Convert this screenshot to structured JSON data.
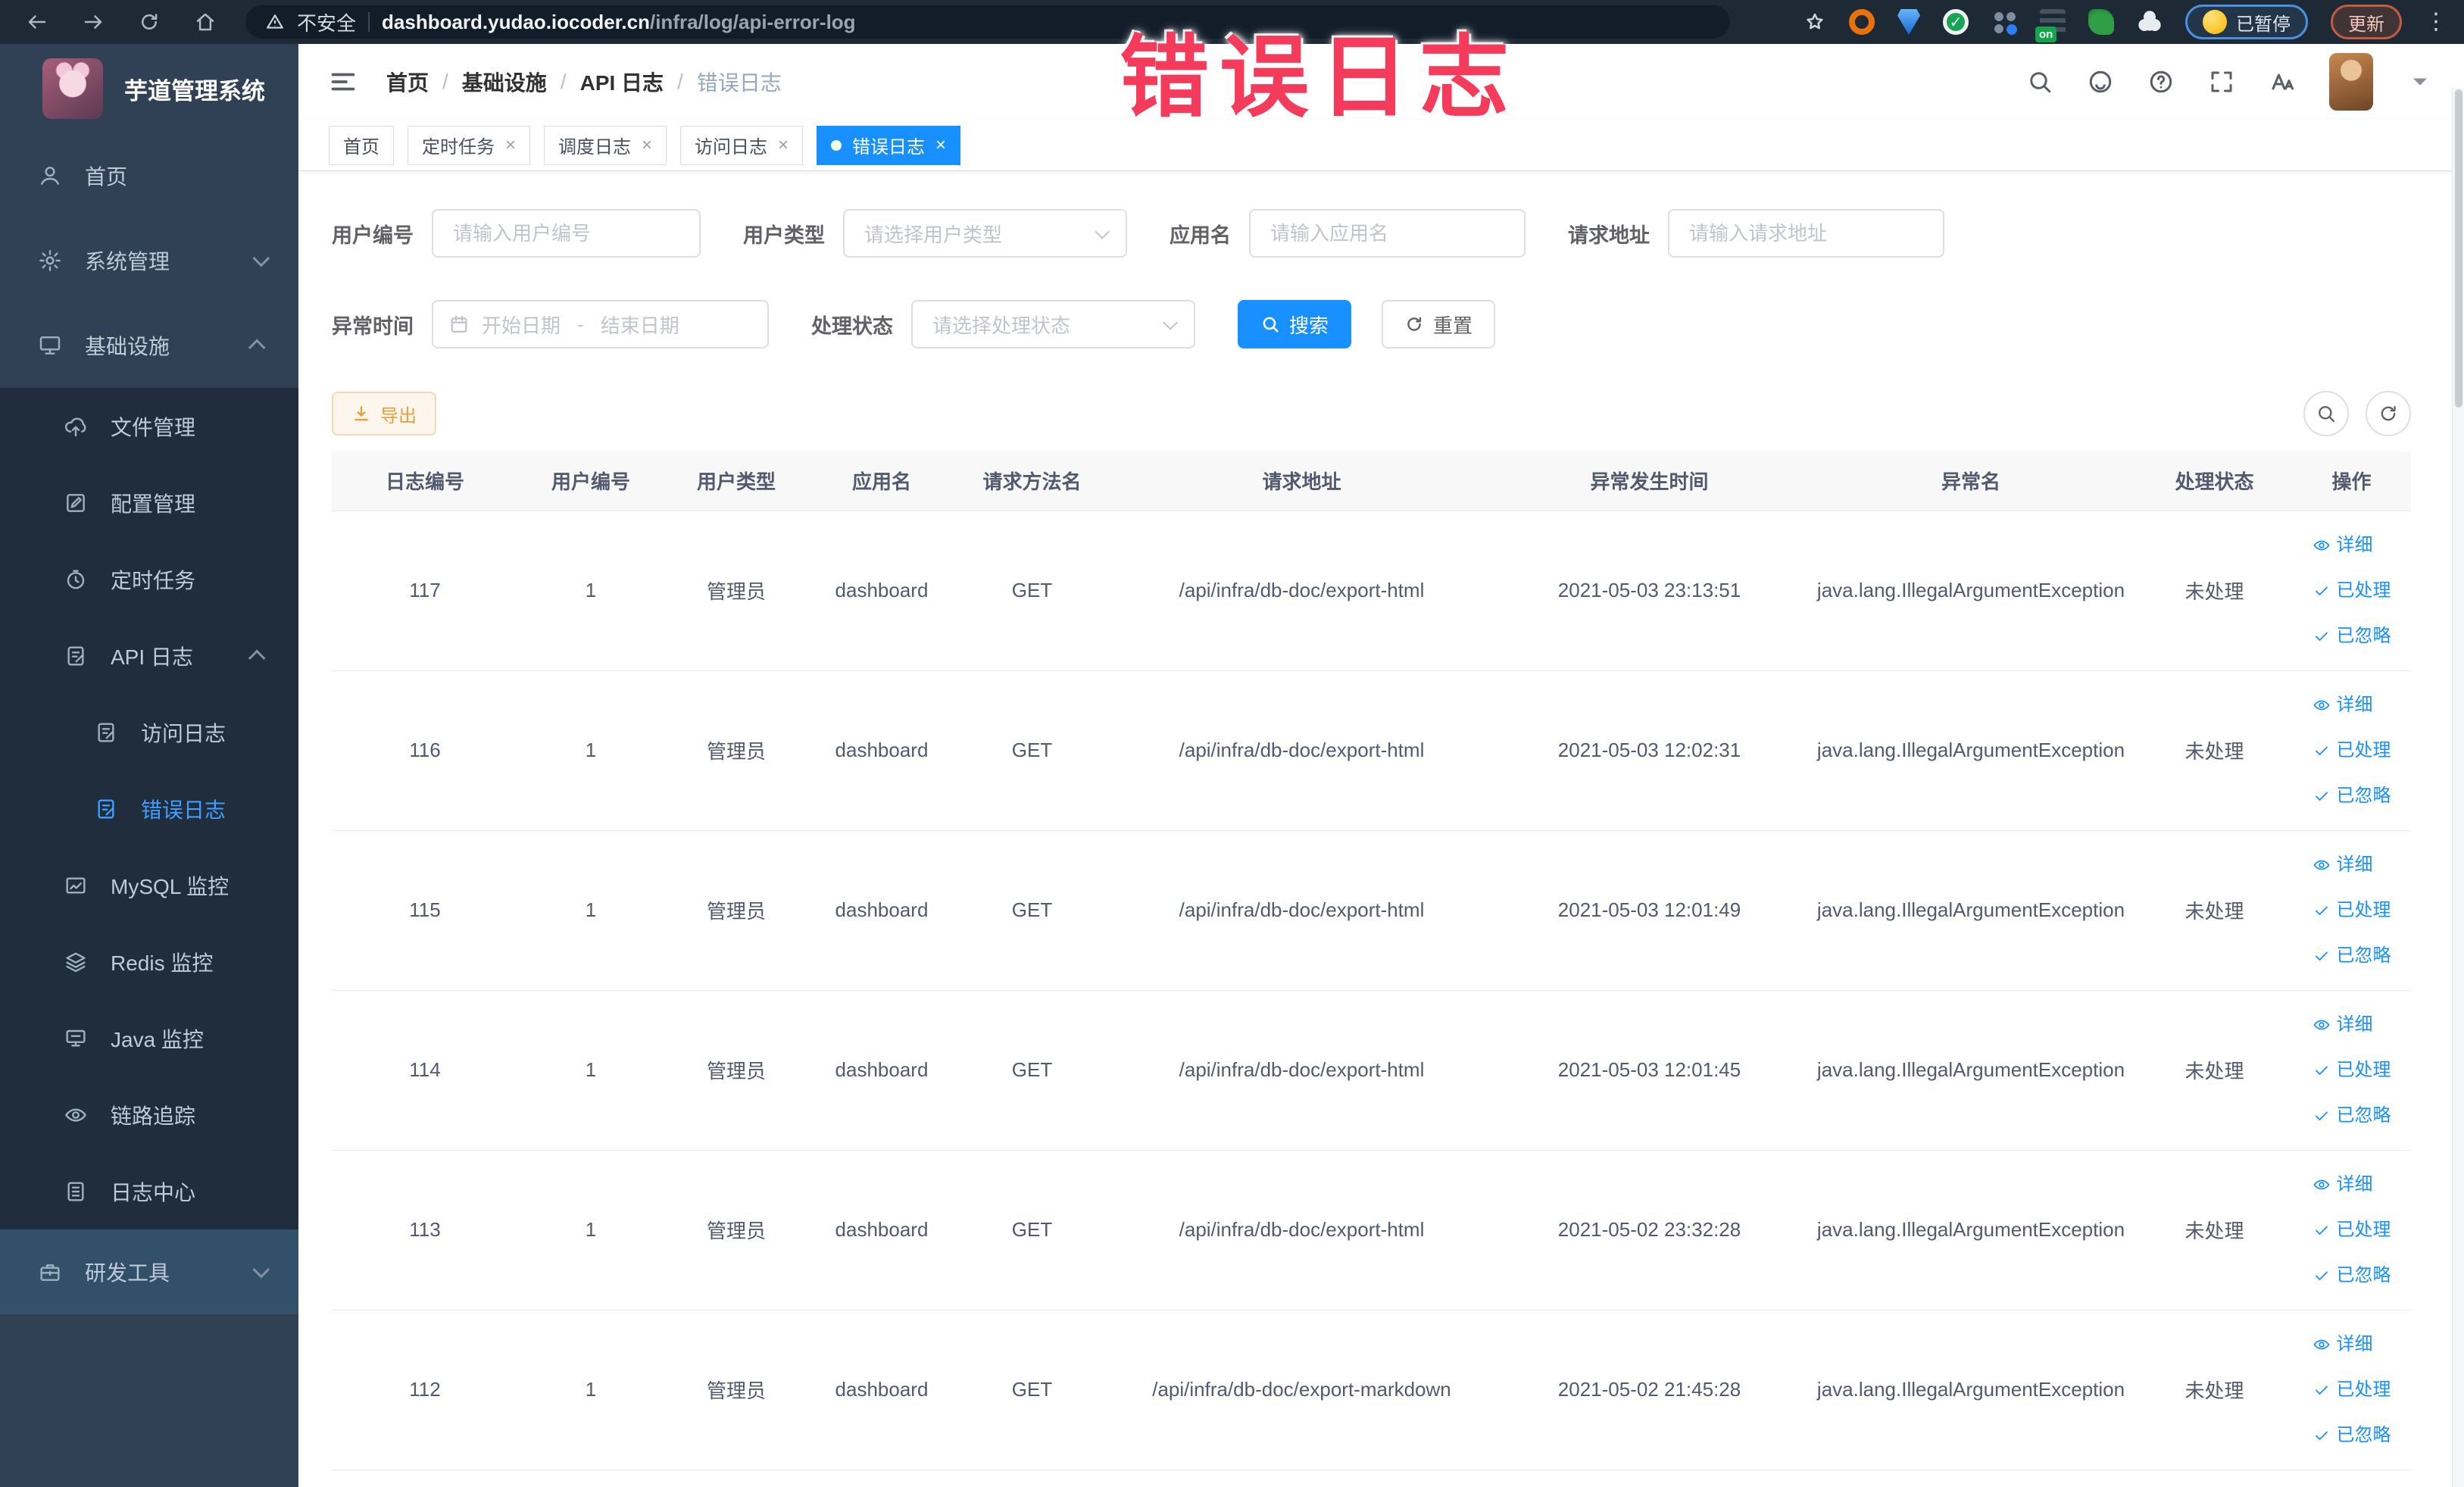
{
  "colors": {
    "primary": "#1890ff",
    "sidebar_bg": "#304156",
    "submenu_bg": "#1f2d3d",
    "active_text": "#409eff",
    "warning": "#e6a23c",
    "annotation": "#f43b5c",
    "browser_bar": "#1d2935"
  },
  "annotation": {
    "text": "错误日志"
  },
  "browser": {
    "security_label": "不安全",
    "url_host": "dashboard.yudao.iocoder.cn",
    "url_path": "/infra/log/api-error-log",
    "on_badge": "on",
    "paused_chip": "已暂停",
    "update_chip": "更新"
  },
  "sidebar": {
    "title": "芋道管理系统",
    "items": [
      {
        "id": "home",
        "label": "首页",
        "icon": "user"
      },
      {
        "id": "system",
        "label": "系统管理",
        "icon": "gear",
        "chevron": "down"
      },
      {
        "id": "infra",
        "label": "基础设施",
        "icon": "monitor",
        "chevron": "up",
        "children": [
          {
            "id": "file",
            "label": "文件管理",
            "icon": "cloud-upload"
          },
          {
            "id": "config",
            "label": "配置管理",
            "icon": "edit"
          },
          {
            "id": "job",
            "label": "定时任务",
            "icon": "timer"
          },
          {
            "id": "api-log",
            "label": "API 日志",
            "icon": "doc-edit",
            "chevron": "up",
            "children": [
              {
                "id": "access-log",
                "label": "访问日志",
                "icon": "doc-edit"
              },
              {
                "id": "error-log",
                "label": "错误日志",
                "icon": "doc-edit",
                "active": true
              }
            ]
          },
          {
            "id": "mysql",
            "label": "MySQL 监控",
            "icon": "chart-frame"
          },
          {
            "id": "redis",
            "label": "Redis 监控",
            "icon": "layers"
          },
          {
            "id": "java",
            "label": "Java 监控",
            "icon": "display"
          },
          {
            "id": "trace",
            "label": "链路追踪",
            "icon": "eye"
          },
          {
            "id": "log-center",
            "label": "日志中心",
            "icon": "log"
          }
        ]
      },
      {
        "id": "dev-tools",
        "label": "研发工具",
        "icon": "toolbox",
        "chevron": "down",
        "highlight": true
      }
    ]
  },
  "header": {
    "breadcrumb": [
      "首页",
      "基础设施",
      "API 日志",
      "错误日志"
    ]
  },
  "tabs": [
    {
      "label": "首页",
      "closable": false,
      "active": false
    },
    {
      "label": "定时任务",
      "closable": true,
      "active": false
    },
    {
      "label": "调度日志",
      "closable": true,
      "active": false
    },
    {
      "label": "访问日志",
      "closable": true,
      "active": false
    },
    {
      "label": "错误日志",
      "closable": true,
      "active": true
    }
  ],
  "filters": {
    "items": [
      {
        "label": "用户编号",
        "placeholder": "请输入用户编号",
        "type": "input"
      },
      {
        "label": "用户类型",
        "placeholder": "请选择用户类型",
        "type": "select"
      },
      {
        "label": "应用名",
        "placeholder": "请输入应用名",
        "type": "input"
      },
      {
        "label": "请求地址",
        "placeholder": "请输入请求地址",
        "type": "input"
      },
      {
        "label": "异常时间",
        "start_placeholder": "开始日期",
        "separator": "-",
        "end_placeholder": "结束日期",
        "type": "daterange"
      },
      {
        "label": "处理状态",
        "placeholder": "请选择处理状态",
        "type": "select"
      }
    ],
    "search_label": "搜索",
    "reset_label": "重置"
  },
  "toolbar": {
    "export_label": "导出"
  },
  "table": {
    "columns": [
      "日志编号",
      "用户编号",
      "用户类型",
      "应用名",
      "请求方法名",
      "请求地址",
      "异常发生时间",
      "异常名",
      "处理状态",
      "操作"
    ],
    "actions": [
      {
        "label": "详细",
        "icon": "eye"
      },
      {
        "label": "已处理",
        "icon": "check"
      },
      {
        "label": "已忽略",
        "icon": "check"
      }
    ],
    "rows": [
      {
        "id": "117",
        "user": "1",
        "type": "管理员",
        "app": "dashboard",
        "method": "GET",
        "url": "/api/infra/db-doc/export-html",
        "time": "2021-05-03 23:13:51",
        "exception": "java.lang.IllegalArgumentException",
        "status": "未处理"
      },
      {
        "id": "116",
        "user": "1",
        "type": "管理员",
        "app": "dashboard",
        "method": "GET",
        "url": "/api/infra/db-doc/export-html",
        "time": "2021-05-03 12:02:31",
        "exception": "java.lang.IllegalArgumentException",
        "status": "未处理"
      },
      {
        "id": "115",
        "user": "1",
        "type": "管理员",
        "app": "dashboard",
        "method": "GET",
        "url": "/api/infra/db-doc/export-html",
        "time": "2021-05-03 12:01:49",
        "exception": "java.lang.IllegalArgumentException",
        "status": "未处理"
      },
      {
        "id": "114",
        "user": "1",
        "type": "管理员",
        "app": "dashboard",
        "method": "GET",
        "url": "/api/infra/db-doc/export-html",
        "time": "2021-05-03 12:01:45",
        "exception": "java.lang.IllegalArgumentException",
        "status": "未处理"
      },
      {
        "id": "113",
        "user": "1",
        "type": "管理员",
        "app": "dashboard",
        "method": "GET",
        "url": "/api/infra/db-doc/export-html",
        "time": "2021-05-02 23:32:28",
        "exception": "java.lang.IllegalArgumentException",
        "status": "未处理"
      },
      {
        "id": "112",
        "user": "1",
        "type": "管理员",
        "app": "dashboard",
        "method": "GET",
        "url": "/api/infra/db-doc/export-markdown",
        "time": "2021-05-02 21:45:28",
        "exception": "java.lang.IllegalArgumentException",
        "status": "未处理"
      }
    ]
  }
}
